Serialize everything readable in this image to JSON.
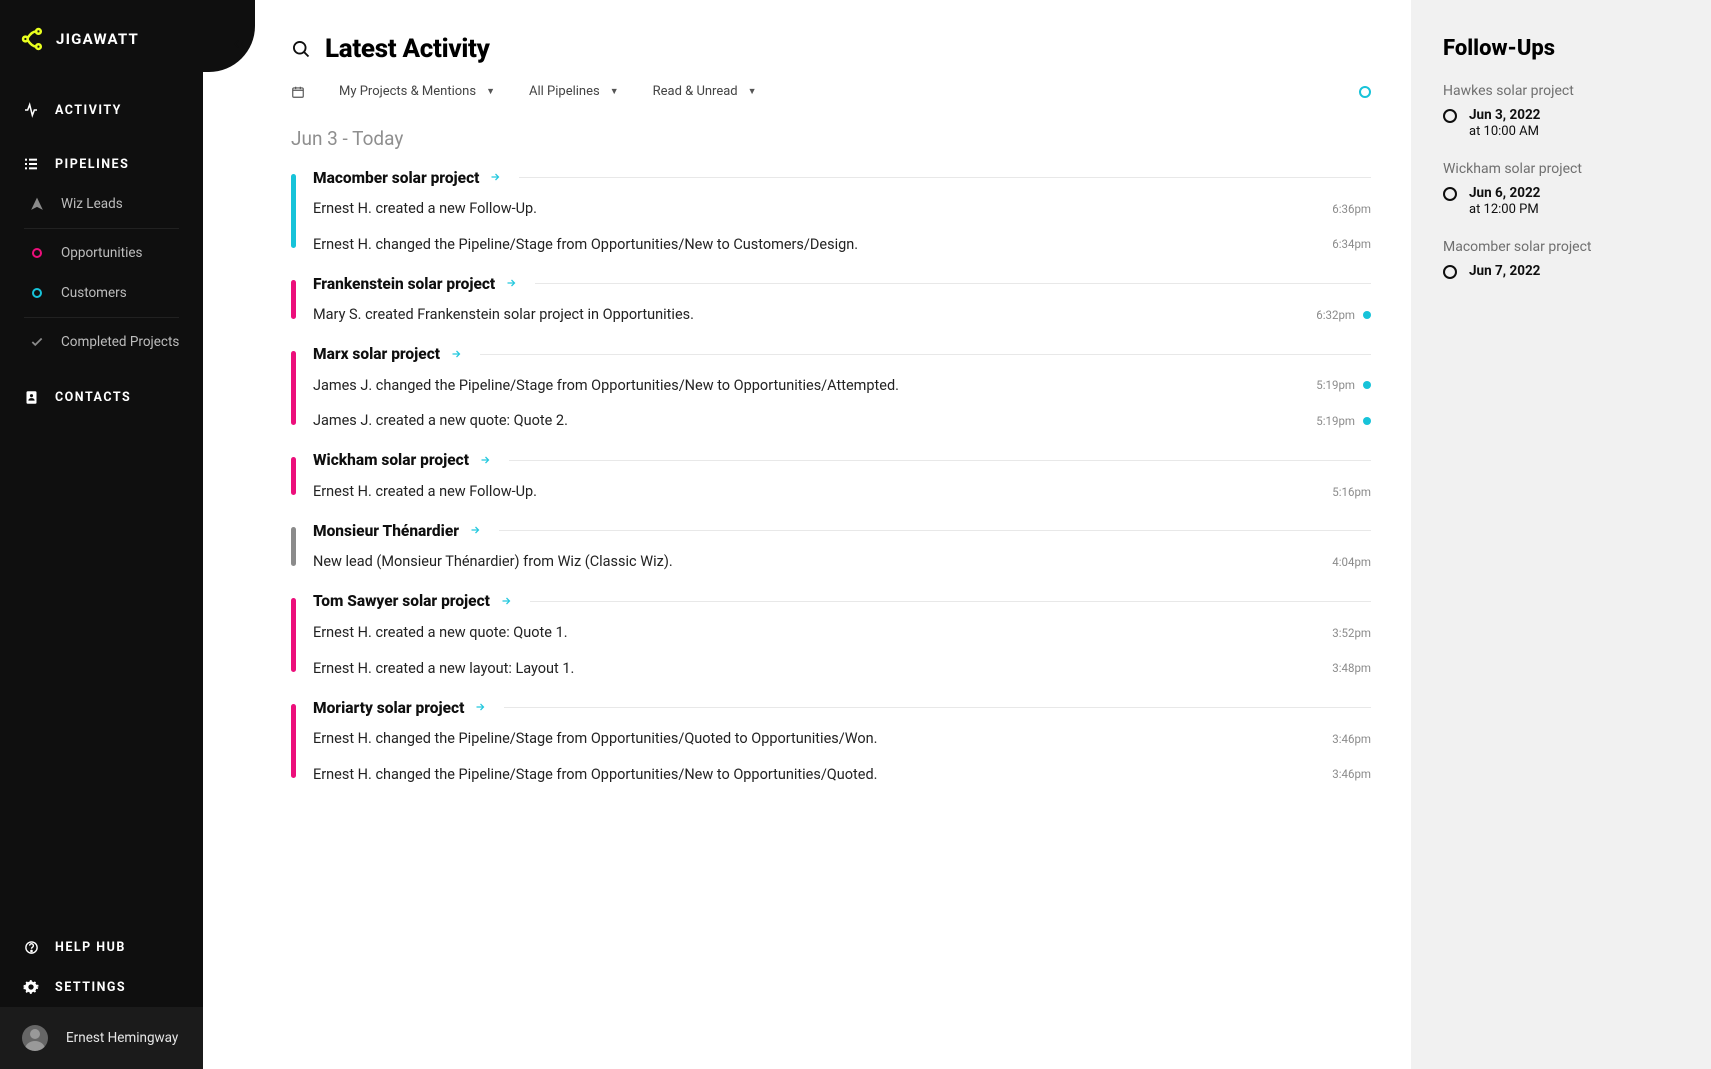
{
  "brand": {
    "name": "JIGAWATT"
  },
  "sidebar": {
    "activity": "ACTIVITY",
    "pipelines": "PIPELINES",
    "wiz_leads": "Wiz Leads",
    "opportunities": "Opportunities",
    "customers": "Customers",
    "completed": "Completed Projects",
    "contacts": "CONTACTS",
    "help": "HELP HUB",
    "settings": "SETTINGS"
  },
  "user": {
    "name": "Ernest Hemingway"
  },
  "page": {
    "title": "Latest Activity"
  },
  "filters": {
    "scope": "My Projects & Mentions",
    "pipeline": "All Pipelines",
    "read": "Read & Unread"
  },
  "date_heading": "Jun 3 - Today",
  "colors": {
    "cyan": "#17c3d9",
    "pink": "#ec0f7b",
    "gray": "#8b8b8b"
  },
  "groups": [
    {
      "title": "Macomber solar project",
      "color": "cyan",
      "rows": [
        {
          "text": "Ernest H. created a new Follow-Up.",
          "time": "6:36pm",
          "unread": false
        },
        {
          "text": "Ernest H. changed the Pipeline/Stage from Opportunities/New to Customers/Design.",
          "time": "6:34pm",
          "unread": false
        }
      ]
    },
    {
      "title": "Frankenstein solar project",
      "color": "pink",
      "rows": [
        {
          "text": "Mary S. created Frankenstein solar project in Opportunities.",
          "time": "6:32pm",
          "unread": true
        }
      ]
    },
    {
      "title": "Marx solar project",
      "color": "pink",
      "rows": [
        {
          "text": "James J. changed the Pipeline/Stage from Opportunities/New to Opportunities/Attempted.",
          "time": "5:19pm",
          "unread": true
        },
        {
          "text": "James J. created a new quote: Quote 2.",
          "time": "5:19pm",
          "unread": true
        }
      ]
    },
    {
      "title": "Wickham solar project",
      "color": "pink",
      "rows": [
        {
          "text": "Ernest H. created a new Follow-Up.",
          "time": "5:16pm",
          "unread": false
        }
      ]
    },
    {
      "title": "Monsieur Thénardier",
      "color": "gray",
      "rows": [
        {
          "text": "New lead (Monsieur Thénardier) from Wiz (Classic Wiz).",
          "time": "4:04pm",
          "unread": false
        }
      ]
    },
    {
      "title": "Tom Sawyer solar project",
      "color": "pink",
      "rows": [
        {
          "text": "Ernest H. created a new quote: Quote 1.",
          "time": "3:52pm",
          "unread": false
        },
        {
          "text": "Ernest H. created a new layout: Layout 1.",
          "time": "3:48pm",
          "unread": false
        }
      ]
    },
    {
      "title": "Moriarty solar project",
      "color": "pink",
      "rows": [
        {
          "text": "Ernest H. changed the Pipeline/Stage from Opportunities/Quoted to Opportunities/Won.",
          "time": "3:46pm",
          "unread": false
        },
        {
          "text": "Ernest H. changed the Pipeline/Stage from Opportunities/New to Opportunities/Quoted.",
          "time": "3:46pm",
          "unread": false
        }
      ]
    }
  ],
  "followups": {
    "title": "Follow-Ups",
    "items": [
      {
        "project": "Hawkes solar project",
        "date": "Jun 3, 2022",
        "time": "at 10:00 AM"
      },
      {
        "project": "Wickham solar project",
        "date": "Jun 6, 2022",
        "time": "at 12:00 PM"
      },
      {
        "project": "Macomber solar project",
        "date": "Jun 7, 2022",
        "time": ""
      }
    ]
  }
}
